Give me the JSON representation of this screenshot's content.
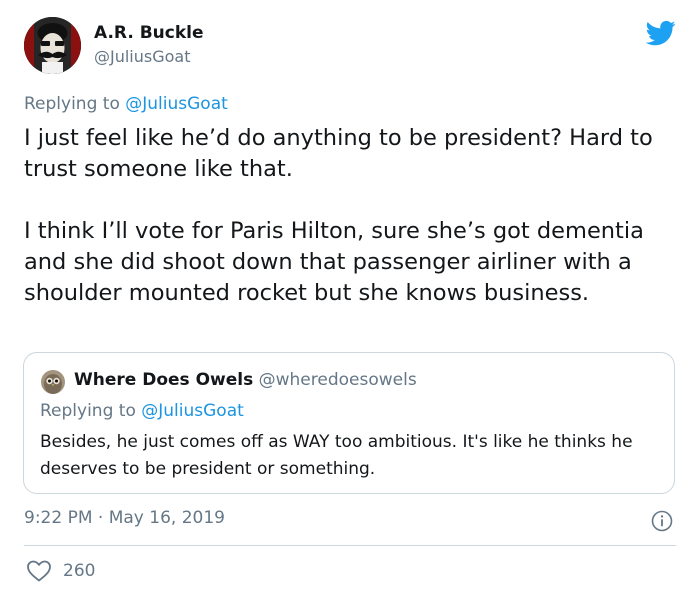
{
  "tweet": {
    "author": {
      "name": "A.R. Buckle",
      "handle": "@JuliusGoat",
      "avatar_icon": "avatar-man-mustache"
    },
    "replying_prefix": "Replying to",
    "replying_handle": "@JuliusGoat",
    "paragraphs": [
      "I just feel like he’d do anything to be president? Hard to trust someone like that.",
      "I think I’ll vote for Paris Hilton, sure she’s got dementia and she did shoot down that passenger airliner with a shoulder mounted rocket but she knows business."
    ],
    "quoted": {
      "name": "Where Does Owels",
      "handle": "@wheredoesowels",
      "avatar_icon": "owl-avatar",
      "replying_prefix": "Replying to",
      "replying_handle": "@JuliusGoat",
      "text": "Besides, he just comes off as WAY too ambitious. It's like he thinks he deserves to be president or something."
    },
    "time": "9:22 PM",
    "separator": " · ",
    "date": "May 16, 2019",
    "like_count": "260"
  },
  "icons": {
    "platform": "twitter-bird-icon",
    "info": "info-icon",
    "like": "heart-icon"
  },
  "colors": {
    "brand": "#1da1f2",
    "link": "#1b95e0",
    "text": "#14171a",
    "muted": "#657786",
    "border": "#ccd6dd"
  }
}
